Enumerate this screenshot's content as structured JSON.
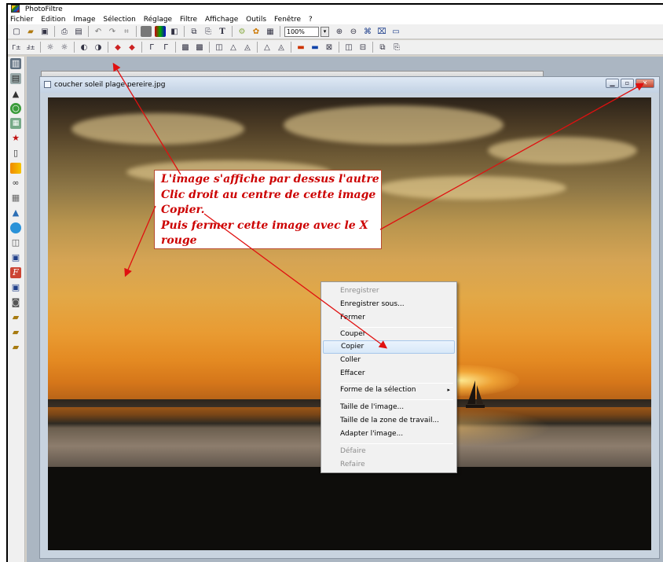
{
  "app": {
    "title": "PhotoFiltre"
  },
  "menu": [
    "Fichier",
    "Edition",
    "Image",
    "Sélection",
    "Réglage",
    "Filtre",
    "Affichage",
    "Outils",
    "Fenêtre",
    "?"
  ],
  "toolbar": {
    "zoom_value": "100%"
  },
  "image_window": {
    "title": "coucher soleil plage pereire.jpg"
  },
  "annotation": {
    "lines": [
      "L'image s'affiche par dessus l'autre",
      "Clic droit au centre de cette image",
      "Copier.",
      "Puis fermer cette image avec le X rouge"
    ],
    "color": "#cc0000"
  },
  "context_menu": {
    "items": [
      {
        "label": "Enregistrer",
        "disabled": true
      },
      {
        "label": "Enregistrer sous...",
        "disabled": false
      },
      {
        "label": "Fermer",
        "disabled": false
      },
      {
        "label": "Couper",
        "disabled": false
      },
      {
        "label": "Copier",
        "disabled": false,
        "highlighted": true
      },
      {
        "label": "Coller",
        "disabled": false
      },
      {
        "label": "Effacer",
        "disabled": false
      },
      {
        "label": "Forme de la sélection",
        "disabled": false,
        "submenu": "▸"
      },
      {
        "label": "Taille de l'image...",
        "disabled": false
      },
      {
        "label": "Taille de la zone de travail...",
        "disabled": false
      },
      {
        "label": "Adapter l'image...",
        "disabled": false
      },
      {
        "label": "Défaire",
        "disabled": true
      },
      {
        "label": "Refaire",
        "disabled": true
      }
    ]
  },
  "icons": {
    "toolbar_1": [
      "new-icon",
      "open-icon",
      "save-icon",
      "print-icon",
      "scan-icon",
      "undo-icon",
      "redo-icon",
      "crop-icon",
      "gray-icon",
      "rgb-icon",
      "channels-icon",
      "duplicate-icon",
      "paste-icon",
      "text-icon",
      "effects-icon",
      "plugin-icon",
      "window-icon",
      "zoom-in-icon",
      "zoom-out-icon",
      "fit-icon",
      "fullscreen-icon",
      "display-icon"
    ],
    "toolbar_2": [
      "auto-level-icon",
      "auto-contrast-icon",
      "brightness-minus-icon",
      "brightness-plus-icon",
      "contrast-minus-icon",
      "contrast-plus-icon",
      "saturation-minus-icon",
      "saturation-plus-icon",
      "gamma-minus-icon",
      "gamma-plus-icon",
      "filter-a-icon",
      "filter-b-icon",
      "blur-icon",
      "sharpen-icon",
      "sharpen-more-icon",
      "soften-icon",
      "soften-more-icon",
      "color-a-icon",
      "color-b-icon",
      "mirror-icon",
      "flip-icon",
      "rotate-icon",
      "image-list-icon",
      "paste-icon-2"
    ],
    "left_tools": [
      "palette-icon",
      "layer-icon",
      "paint-bucket-icon",
      "globe-icon",
      "grid-icon",
      "star-icon",
      "page-icon",
      "gradient-icon",
      "pattern-icon",
      "mosaic-icon",
      "chart-icon",
      "sphere-icon",
      "frame-icon",
      "save-as-icon",
      "font-icon",
      "html-icon",
      "export-icon",
      "batch-icon",
      "batch2-icon",
      "batch3-icon"
    ]
  }
}
